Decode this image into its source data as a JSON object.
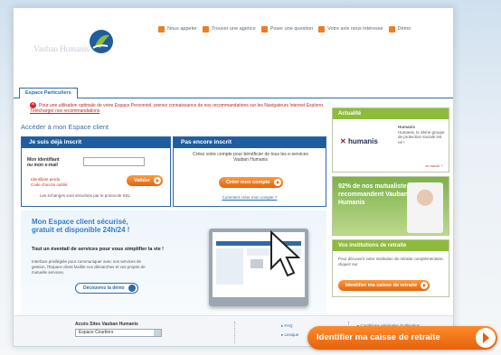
{
  "header": {
    "brand": "Vauban Humanis",
    "nav": [
      {
        "label": "Nous appeler",
        "icon": "phone-icon"
      },
      {
        "label": "Trouver une agence",
        "icon": "home-icon"
      },
      {
        "label": "Poser une question",
        "icon": "chat-icon"
      },
      {
        "label": "Votre avis nous intéresse",
        "icon": "pencil-icon"
      },
      {
        "label": "Démo",
        "icon": "screen-icon"
      }
    ]
  },
  "tab": {
    "label": "Espace Particuliers"
  },
  "alert": {
    "text": "Pour une utilisation optimale de votre Espace Personnel, prenez connaissance de nos recommandations sur les Navigateurs Internet Explorer.",
    "link": "Télécharger nos recommandations"
  },
  "acces_title": "Accéder à mon Espace client",
  "login": {
    "header": "Je suis déjà inscrit",
    "id_label": "Mon identifiant ou mon e-mail",
    "id_value": "",
    "forgot_id": "Identifiant perdu",
    "forgot_code": "Code d'accès oublié",
    "submit": "Valider",
    "note": "Les échanges sont sécurisés par le protocole SSL"
  },
  "register": {
    "header": "Pas encore inscrit",
    "text": "Créez votre compte pour bénéficier de tous les e-services Vauban Humanis",
    "button": "Créer mon compte",
    "link": "Comment créer mon compte ?"
  },
  "promo": {
    "title": "Mon Espace client sécurisé, gratuit et disponible 24h/24 !",
    "subtitle": "Tout un éventail de services pour vous simplifier la vie !",
    "text": "Interface privilégiée pour communiquer avec nos services de gestion, l'Espace client facilite vos démarches et vos projets de mutuelle services.",
    "button": "Découvrez la démo"
  },
  "news": {
    "header": "Actualité",
    "brand": "humanis",
    "brand_title": "Humanis",
    "desc": "Humanis, le 3ème groupe de protection sociale est né !",
    "more": "en savoir +"
  },
  "testimonial": {
    "text": "92% de nos mutualistes recommandent Vauban Humanis"
  },
  "retirement": {
    "header": "Vos institutions de retraite",
    "desc": "Pour découvrir votre institution de retraite complémentaire, cliquez sur",
    "button": "Identifier ma caisse de retraite"
  },
  "footer": {
    "label": "Accès Sites Vauban Humanis",
    "select_value": "Espace Courtiers",
    "links": [
      "FAQ",
      "Lexique",
      "Conditions générales d'utilisation"
    ]
  },
  "cta": {
    "label": "Identifier ma caisse de retraite"
  },
  "colors": {
    "brand_blue": "#1f5d9e",
    "accent_orange": "#e5620c",
    "green": "#8dbb3c"
  }
}
